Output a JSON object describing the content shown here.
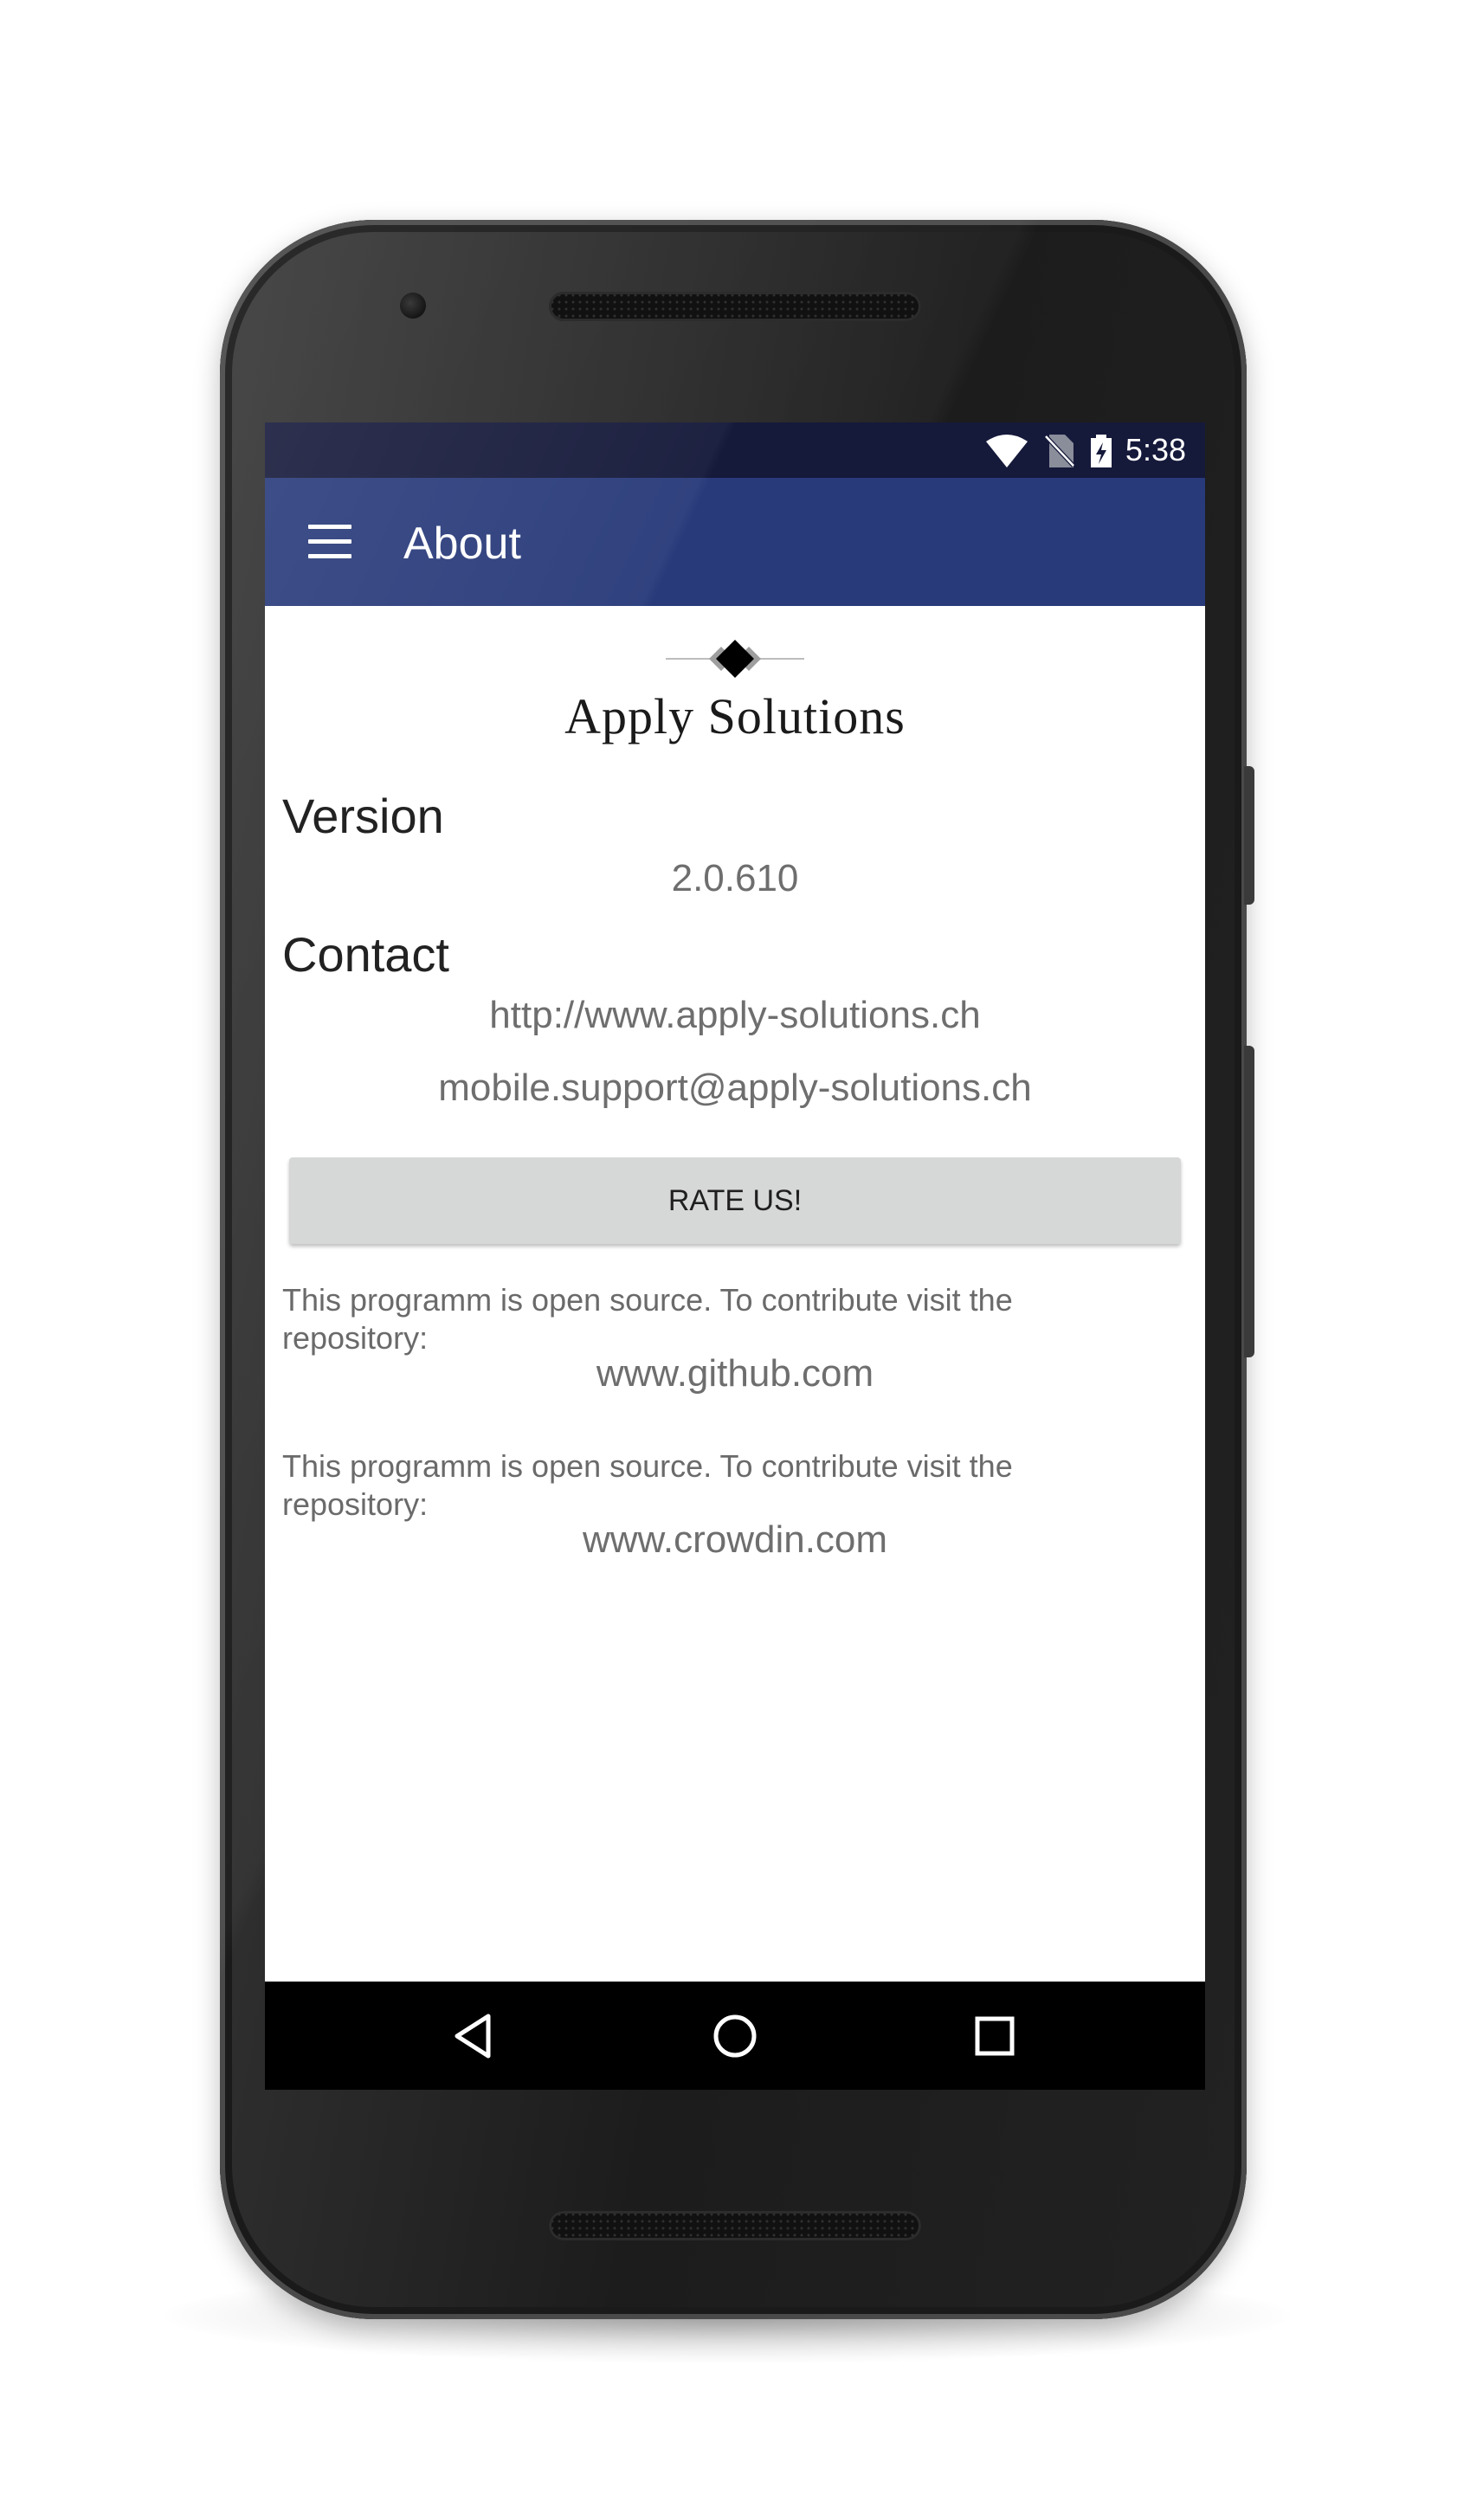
{
  "status_bar": {
    "time": "5:38",
    "icons": [
      "wifi-icon",
      "no-sim-icon",
      "battery-charging-icon"
    ]
  },
  "app_bar": {
    "menu_icon": "hamburger-menu-icon",
    "title": "About",
    "background_color": "#283a7a"
  },
  "logo": {
    "text": "Apply Solutions"
  },
  "version": {
    "heading": "Version",
    "value": "2.0.610"
  },
  "contact": {
    "heading": "Contact",
    "website": "http://www.apply-solutions.ch",
    "email": "mobile.support@apply-solutions.ch"
  },
  "rate_button": {
    "label": "RATE US!"
  },
  "open_source_github": {
    "text": "This programm is open source. To contribute visit the repository:",
    "link": "www.github.com"
  },
  "open_source_crowdin": {
    "text": "This programm is open source. To contribute visit the repository:",
    "link": "www.crowdin.com"
  },
  "nav_bar": {
    "buttons": [
      "back-icon",
      "home-icon",
      "recents-icon"
    ]
  }
}
